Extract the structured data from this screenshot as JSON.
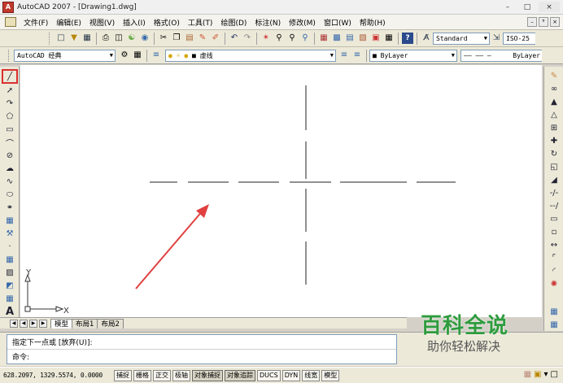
{
  "window": {
    "title": "AutoCAD 2007 - [Drawing1.dwg]",
    "minimize": "–",
    "maximize": "□",
    "close": "×"
  },
  "menubar": {
    "items": [
      "文件(F)",
      "编辑(E)",
      "视图(V)",
      "插入(I)",
      "格式(O)",
      "工具(T)",
      "绘图(D)",
      "标注(N)",
      "修改(M)",
      "窗口(W)",
      "帮助(H)"
    ],
    "mdi": [
      "–",
      "ᴮ",
      "×"
    ]
  },
  "toolbar1": {
    "text_style": "Standard",
    "dim_style": "ISO-25"
  },
  "toolbar2": {
    "workspace": "AutoCAD 经典",
    "layer": "虚线",
    "color": "ByLayer",
    "linetype": "ByLayer",
    "linetype_preview": "—— —— —"
  },
  "left_toolbar": [
    "line-icon",
    "construction-line-icon",
    "polyline-icon",
    "polygon-icon",
    "rectangle-icon",
    "arc-icon",
    "circle-icon",
    "revision-cloud-icon",
    "spline-icon",
    "ellipse-icon",
    "ellipse-arc-icon",
    "insert-block-icon",
    "make-block-icon",
    "point-icon",
    "hatch-icon",
    "gradient-icon",
    "region-icon",
    "table-icon",
    "multiline-text-icon"
  ],
  "right_toolbar": [
    "erase-icon",
    "copy-icon",
    "mirror-icon",
    "offset-icon",
    "array-icon",
    "move-icon",
    "rotate-icon",
    "scale-icon",
    "stretch-icon",
    "trim-icon",
    "extend-icon",
    "break-at-point-icon",
    "break-icon",
    "join-icon",
    "chamfer-icon",
    "fillet-icon",
    "explode-icon"
  ],
  "ucs": {
    "x": "X",
    "y": "Y"
  },
  "tabs": {
    "model": "模型",
    "layout1": "布局1",
    "layout2": "布局2"
  },
  "command": {
    "line1": "指定下一点或 [放弃(U)]:",
    "line2": "命令:"
  },
  "status": {
    "coords": "628.2097, 1329.5574, 0.0000",
    "buttons": [
      "捕捉",
      "栅格",
      "正交",
      "极轴",
      "对象捕捉",
      "对象追踪",
      "DUCS",
      "DYN",
      "线宽",
      "模型"
    ]
  },
  "watermark": {
    "title": "百科全说",
    "subtitle": "助你轻松解决"
  },
  "colors": {
    "annotation": "#e04040",
    "watermark_green": "#2e9c3e",
    "highlight": "#d93030"
  }
}
